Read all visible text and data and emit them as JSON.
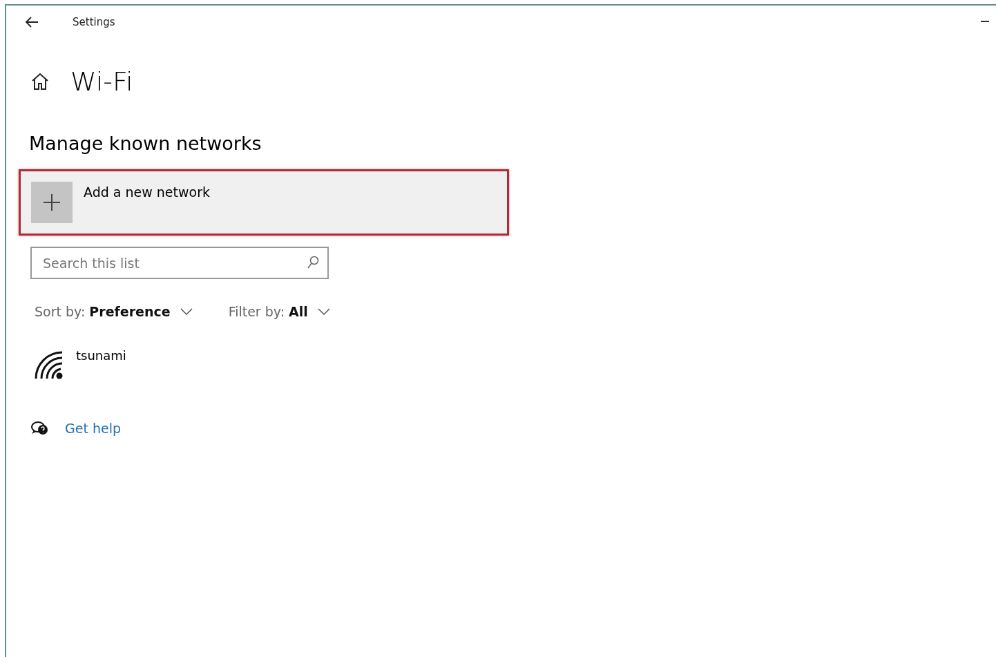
{
  "window": {
    "title": "Settings"
  },
  "page_title": "Wi-Fi",
  "section_title": "Manage known networks",
  "add_network": {
    "label": "Add a new network",
    "highlighted": true
  },
  "search": {
    "placeholder": "Search this list"
  },
  "sort": {
    "label": "Sort by:",
    "value": "Preference"
  },
  "filter": {
    "label": "Filter by:",
    "value": "All"
  },
  "networks": [
    {
      "name": "tsunami"
    }
  ],
  "help_link": "Get help"
}
